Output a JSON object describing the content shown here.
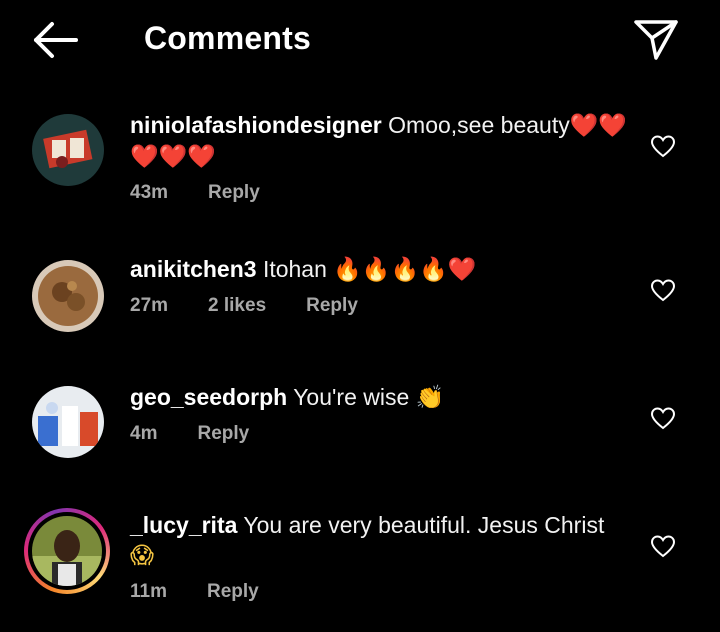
{
  "header": {
    "title": "Comments",
    "back_icon": "arrow-left-icon",
    "share_icon": "paper-plane-icon"
  },
  "comments": [
    {
      "username": "niniolafashiondesigner",
      "text": "Omoo,see beauty",
      "emojis": "❤️❤️❤️❤️❤️",
      "time": "43m",
      "likes": "",
      "reply_label": "Reply"
    },
    {
      "username": "anikitchen3",
      "text": "Itohan",
      "emojis": "🔥🔥🔥🔥❤️",
      "time": "27m",
      "likes": "2 likes",
      "reply_label": "Reply"
    },
    {
      "username": "geo_seedorph",
      "text": "You're wise",
      "emojis": "👏",
      "time": "4m",
      "likes": "",
      "reply_label": "Reply"
    },
    {
      "username": "_lucy_rita",
      "text": "You are very beautiful.  Jesus Christ",
      "emojis": "😱",
      "time": "11m",
      "likes": "",
      "reply_label": "Reply"
    }
  ],
  "colors": {
    "background": "#000000",
    "text": "#ffffff",
    "meta": "#a8a8a8",
    "heart": "#e0245e",
    "fire": "#ff8c1a"
  }
}
